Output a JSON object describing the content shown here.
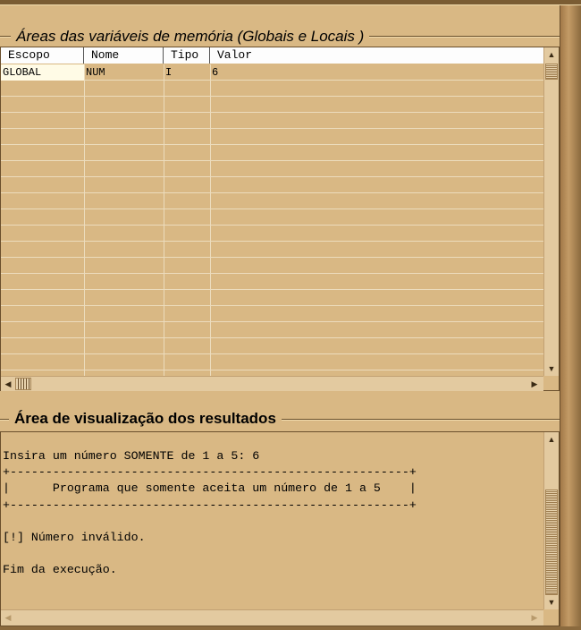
{
  "memory_area": {
    "title": "Áreas das variáveis de memória (Globais e Locais )",
    "columns": [
      "Escopo",
      "Nome",
      "Tipo",
      "Valor"
    ],
    "rows": [
      {
        "escopo": "GLOBAL",
        "nome": "NUM",
        "tipo": "I",
        "valor": "6"
      }
    ]
  },
  "results_area": {
    "title": "Área de visualização dos resultados",
    "lines": [
      "Insira um número SOMENTE de 1 a 5: 6",
      "+--------------------------------------------------------+",
      "|      Programa que somente aceita um número de 1 a 5    |",
      "+--------------------------------------------------------+",
      "",
      "[!] Número inválido.",
      "",
      "Fim da execução."
    ]
  },
  "icons": {
    "scroll_up": "scroll-up-arrow-icon",
    "scroll_down": "scroll-down-arrow-icon",
    "scroll_left": "scroll-left-arrow-icon",
    "scroll_right": "scroll-right-arrow-icon"
  },
  "colors": {
    "background": "#d9b884",
    "frame": "#a27848",
    "header": "#ffffff",
    "selected_cell": "#fffbe6"
  }
}
